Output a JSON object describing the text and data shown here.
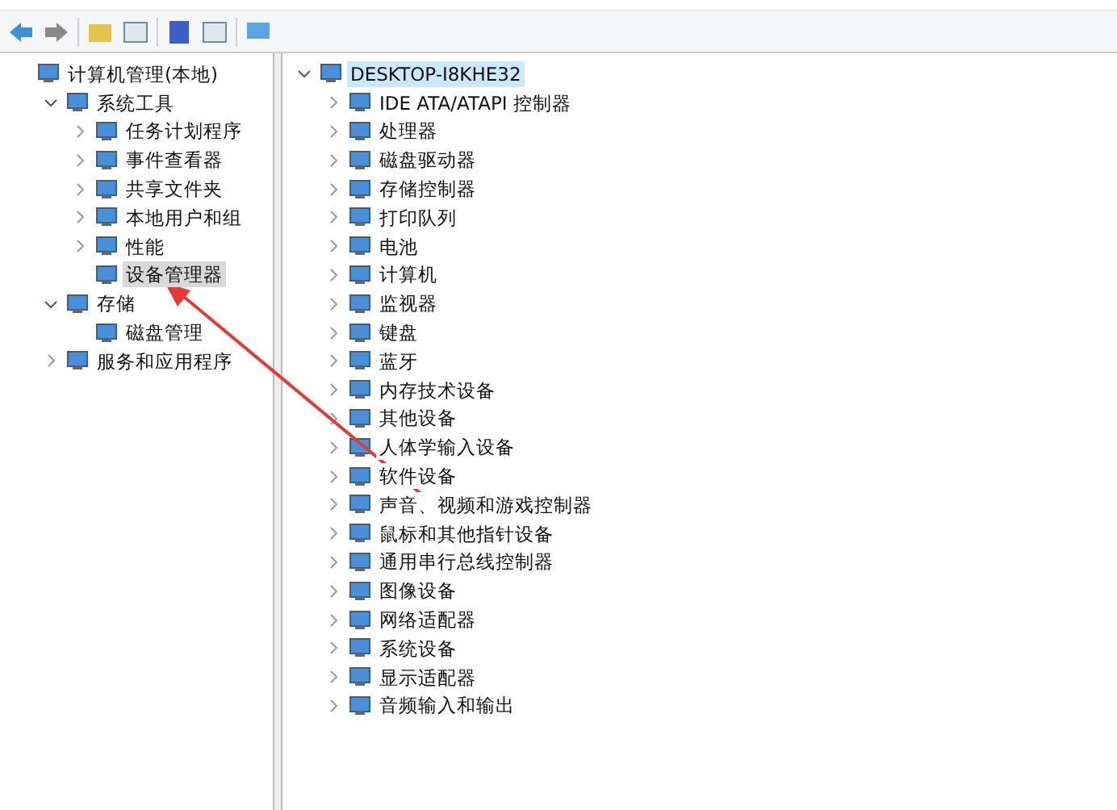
{
  "navigation_tree": [
    {
      "label": "计算机管理(本地)",
      "selected": false,
      "children": [
        {
          "label": "系统工具",
          "expanded": true,
          "selected": false,
          "children": [
            {
              "label": "任务计划程序",
              "expanded": false,
              "selected": false
            },
            {
              "label": "事件查看器",
              "expanded": false,
              "selected": false
            },
            {
              "label": "共享文件夹",
              "expanded": false,
              "selected": false
            },
            {
              "label": "本地用户和组",
              "expanded": false,
              "selected": false
            },
            {
              "label": "性能",
              "expanded": false,
              "selected": false
            },
            {
              "label": "设备管理器",
              "selected": true
            }
          ]
        },
        {
          "label": "存储",
          "expanded": true,
          "selected": false,
          "children": [
            {
              "label": "磁盘管理",
              "selected": false
            }
          ]
        },
        {
          "label": "服务和应用程序",
          "expanded": false,
          "selected": false
        }
      ]
    }
  ],
  "device_tree": [
    {
      "label": "DESKTOP-I8KHE32",
      "expanded": true,
      "selected": true,
      "children": [
        {
          "label": "IDE ATA/ATAPI 控制器",
          "expanded": false,
          "selected": false
        },
        {
          "label": "处理器",
          "expanded": false,
          "selected": false
        },
        {
          "label": "磁盘驱动器",
          "expanded": false,
          "selected": false
        },
        {
          "label": "存储控制器",
          "expanded": false,
          "selected": false
        },
        {
          "label": "打印队列",
          "expanded": false,
          "selected": false
        },
        {
          "label": "电池",
          "expanded": false,
          "selected": false
        },
        {
          "label": "计算机",
          "expanded": false,
          "selected": false
        },
        {
          "label": "监视器",
          "expanded": false,
          "selected": false
        },
        {
          "label": "键盘",
          "expanded": false,
          "selected": false
        },
        {
          "label": "蓝牙",
          "expanded": false,
          "selected": false
        },
        {
          "label": "内存技术设备",
          "expanded": false,
          "selected": false
        },
        {
          "label": "其他设备",
          "expanded": false,
          "selected": false
        },
        {
          "label": "人体学输入设备",
          "expanded": false,
          "selected": false
        },
        {
          "label": "软件设备",
          "expanded": false,
          "selected": false
        },
        {
          "label": "声音、视频和游戏控制器",
          "expanded": false,
          "selected": false
        },
        {
          "label": "鼠标和其他指针设备",
          "expanded": false,
          "selected": false
        },
        {
          "label": "通用串行总线控制器",
          "expanded": false,
          "selected": false
        },
        {
          "label": "图像设备",
          "expanded": false,
          "selected": false
        },
        {
          "label": "网络适配器",
          "expanded": false,
          "selected": false
        },
        {
          "label": "系统设备",
          "expanded": false,
          "selected": false
        },
        {
          "label": "显示适配器",
          "expanded": false,
          "selected": false
        },
        {
          "label": "音频输入和输出",
          "expanded": false,
          "selected": false
        }
      ]
    }
  ]
}
